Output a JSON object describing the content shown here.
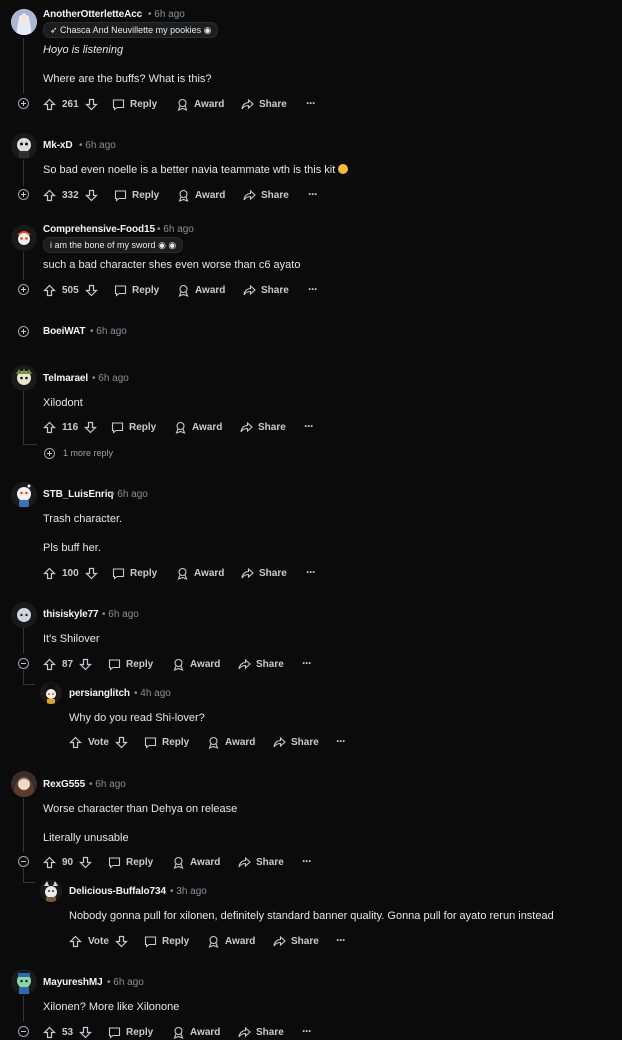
{
  "actions": {
    "reply": "Reply",
    "award": "Award",
    "share": "Share",
    "vote": "Vote"
  },
  "comments": [
    {
      "author": "AnotherOtterletteAcc",
      "time": "6h ago",
      "flair": "Chasca And Neuvillette my pookies",
      "line1": "Hoyo is listening",
      "line2": "Where are the buffs? What is this?",
      "score": "261"
    },
    {
      "author": "Mk-xD",
      "time": "6h ago",
      "line1": "So bad even noelle is a better navia teammate wth is this kit",
      "score": "332"
    },
    {
      "author": "Comprehensive-Food15",
      "time": "6h ago",
      "flair": "i am the bone of my sword",
      "line1": "such a bad character shes even worse than c6 ayato",
      "score": "505"
    },
    {
      "author": "BoeiWAT",
      "time": "6h ago"
    },
    {
      "author": "Telmarael",
      "time": "6h ago",
      "line1": "Xilodont",
      "score": "116",
      "more": "1 more reply"
    },
    {
      "author": "STB_LuisEnriq",
      "time": "6h ago",
      "line1": "Trash character.",
      "line2": "Pls buff her.",
      "score": "100"
    },
    {
      "author": "thisiskyle77",
      "time": "6h ago",
      "line1": "It's Shilover",
      "score": "87"
    },
    {
      "author": "persianglitch",
      "time": "4h ago",
      "line1": "Why do you read Shi-lover?"
    },
    {
      "author": "RexG555",
      "time": "6h ago",
      "line1": "Worse character than Dehya on release",
      "line2": "Literally unusable",
      "score": "90"
    },
    {
      "author": "Delicious-Buffalo734",
      "time": "3h ago",
      "line1": "Nobody gonna pull for xilonen, definitely standard banner quality. Gonna pull for ayato rerun instead"
    },
    {
      "author": "MayureshMJ",
      "time": "6h ago",
      "line1": "Xilonen? More like Xilonone",
      "score": "53"
    }
  ]
}
